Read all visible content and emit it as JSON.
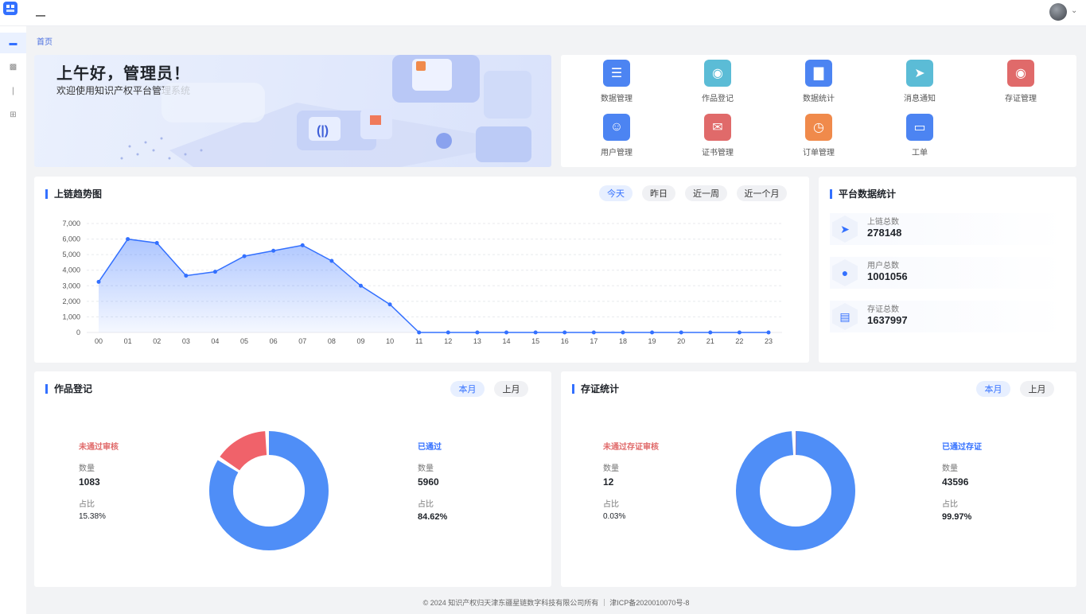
{
  "header": {
    "title": "—",
    "colors": {
      "accent": "#3370ff"
    }
  },
  "sidebar": {
    "items": [
      {
        "icon": "menu-icon"
      },
      {
        "icon": "doc-icon"
      },
      {
        "icon": "info-icon"
      },
      {
        "icon": "grid-icon"
      }
    ]
  },
  "breadcrumb": "首页",
  "banner": {
    "welcome": "上午好，管理员！",
    "subtitle": "欢迎使用知识产权平台管理系统"
  },
  "quick_links": [
    {
      "label": "数据管理",
      "color": "#4c84f2",
      "icon": "server-icon"
    },
    {
      "label": "作品登记",
      "color": "#5bbcd6",
      "icon": "map-pin-icon"
    },
    {
      "label": "数据统计",
      "color": "#4c84f2",
      "icon": "bar-chart-icon"
    },
    {
      "label": "消息通知",
      "color": "#5bbcd6",
      "icon": "send-icon"
    },
    {
      "label": "存证管理",
      "color": "#e06a6a",
      "icon": "record-icon"
    },
    {
      "label": "用户管理",
      "color": "#4c84f2",
      "icon": "user-icon"
    },
    {
      "label": "证书管理",
      "color": "#e06a6a",
      "icon": "certificate-icon"
    },
    {
      "label": "订单管理",
      "color": "#f08a4b",
      "icon": "file-icon"
    },
    {
      "label": "工单",
      "color": "#4c84f2",
      "icon": "ticket-icon"
    }
  ],
  "trend": {
    "title": "上链趋势图",
    "filters": [
      "今天",
      "昨日",
      "近一周",
      "近一个月"
    ],
    "active_filter": "今天"
  },
  "chart_data": {
    "type": "area",
    "title": "上链趋势图",
    "categories": [
      "00",
      "01",
      "02",
      "03",
      "04",
      "05",
      "06",
      "07",
      "08",
      "09",
      "10",
      "11",
      "12",
      "13",
      "14",
      "15",
      "16",
      "17",
      "18",
      "19",
      "20",
      "21",
      "22",
      "23"
    ],
    "values": [
      3250,
      6000,
      5750,
      3650,
      3900,
      4900,
      5250,
      5600,
      4600,
      3000,
      1800,
      0,
      0,
      0,
      0,
      0,
      0,
      0,
      0,
      0,
      0,
      0,
      0,
      0
    ],
    "y_ticks": [
      "0",
      "1,000",
      "2,000",
      "3,000",
      "4,000",
      "5,000",
      "6,000",
      "7,000"
    ],
    "ylim": [
      0,
      7000
    ],
    "grid": true,
    "color": "#3370ff"
  },
  "stats": {
    "title": "平台数据统计",
    "items": [
      {
        "label": "上链总数",
        "value": "278148",
        "icon": "send-icon"
      },
      {
        "label": "用户总数",
        "value": "1001056",
        "icon": "users-icon"
      },
      {
        "label": "存证总数",
        "value": "1637997",
        "icon": "document-icon"
      }
    ]
  },
  "pie1": {
    "title": "作品登记",
    "filters": [
      "本月",
      "上月"
    ],
    "active_filter": "本月",
    "left": {
      "title": "未通过审核",
      "count_label": "数量",
      "count": "1083",
      "ratio_label": "占比",
      "ratio": "15.38%",
      "color": "#e06a6a"
    },
    "right": {
      "title": "已通过",
      "count_label": "数量",
      "count": "5960",
      "ratio_label": "占比",
      "ratio": "84.62%",
      "color": "#3370ff"
    },
    "ring": {
      "red": 15.38,
      "blue": 84.62
    }
  },
  "pie2": {
    "title": "存证统计",
    "filters": [
      "本月",
      "上月"
    ],
    "active_filter": "本月",
    "left": {
      "title": "未通过存证审核",
      "count_label": "数量",
      "count": "12",
      "ratio_label": "占比",
      "ratio": "0.03%",
      "color": "#e06a6a"
    },
    "right": {
      "title": "已通过存证",
      "count_label": "数量",
      "count": "43596",
      "ratio_label": "占比",
      "ratio": "99.97%",
      "color": "#3370ff"
    },
    "ring": {
      "red": 0.03,
      "blue": 99.97
    }
  },
  "footer": "© 2024 知识产权归天津东疆星链数字科技有限公司所有 ｜ 津ICP备2020010070号-8"
}
